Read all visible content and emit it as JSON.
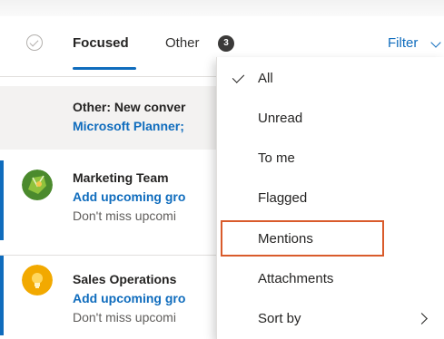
{
  "tabs": {
    "focused_label": "Focused",
    "other_label": "Other",
    "other_count": "3",
    "filter_label": "Filter"
  },
  "other_notice": {
    "title": "Other: New conver",
    "link": "Microsoft Planner;"
  },
  "messages": [
    {
      "sender": "Marketing Team",
      "subject": "Add upcoming gro",
      "preview": "Don't miss upcomi",
      "avatar_colors": [
        "#4b8a2d",
        "#8fc23d"
      ]
    },
    {
      "sender": "Sales Operations",
      "subject": "Add upcoming gro",
      "preview": "Don't miss upcomi",
      "avatar_colors": [
        "#f2a900",
        "#ffd75e"
      ]
    }
  ],
  "filter_menu": {
    "items": [
      {
        "label": "All",
        "checked": true
      },
      {
        "label": "Unread"
      },
      {
        "label": "To me"
      },
      {
        "label": "Flagged"
      },
      {
        "label": "Mentions",
        "highlighted": true
      },
      {
        "label": "Attachments"
      },
      {
        "label": "Sort by",
        "submenu": true
      }
    ]
  },
  "colors": {
    "accent": "#0f6cbd",
    "highlight_border": "#d95b2b",
    "other_row_bg": "#f3f2f1"
  }
}
